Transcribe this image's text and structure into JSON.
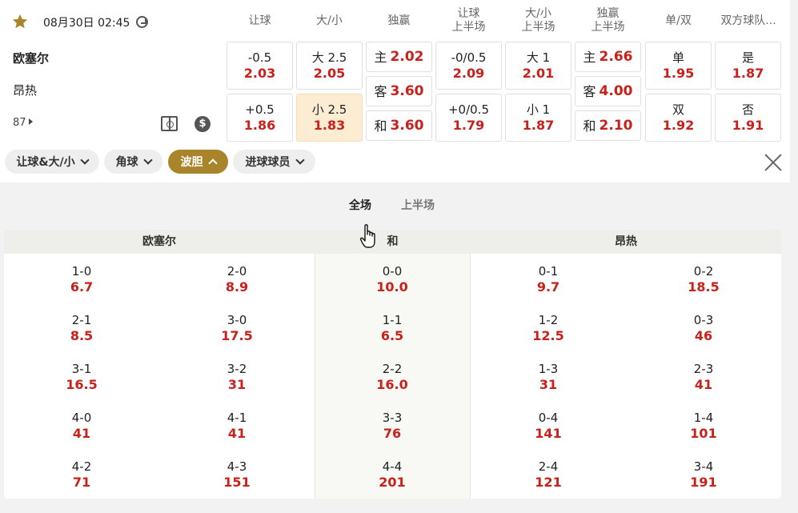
{
  "match": {
    "datetime": "08月30日 02:45",
    "home": "欧塞尔",
    "away": "昂热",
    "more_count": "87"
  },
  "columns": [
    "让球",
    "大/小",
    "独赢",
    "让球\n上半场",
    "大/小\n上半场",
    "独赢\n上半场",
    "单/双",
    "双方球队..."
  ],
  "odds": {
    "hc_top": {
      "line": "-0.5",
      "odds": "2.03"
    },
    "hc_bot": {
      "line": "+0.5",
      "odds": "1.86"
    },
    "ou_top": {
      "line": "大 2.5",
      "odds": "2.05"
    },
    "ou_bot": {
      "line": "小 2.5",
      "odds": "1.83"
    },
    "ml_home": {
      "label": "主",
      "odds": "2.02"
    },
    "ml_away": {
      "label": "客",
      "odds": "3.60"
    },
    "ml_draw": {
      "label": "和",
      "odds": "3.60"
    },
    "hc1h_top": {
      "line": "-0/0.5",
      "odds": "2.09"
    },
    "hc1h_bot": {
      "line": "+0/0.5",
      "odds": "1.79"
    },
    "ou1h_top": {
      "line": "大 1",
      "odds": "2.01"
    },
    "ou1h_bot": {
      "line": "小 1",
      "odds": "1.87"
    },
    "ml1h_home": {
      "label": "主",
      "odds": "2.66"
    },
    "ml1h_away": {
      "label": "客",
      "odds": "4.00"
    },
    "ml1h_draw": {
      "label": "和",
      "odds": "2.10"
    },
    "oe_top": {
      "label": "单",
      "odds": "1.95"
    },
    "oe_bot": {
      "label": "双",
      "odds": "1.92"
    },
    "btts_top": {
      "label": "是",
      "odds": "1.87"
    },
    "btts_bot": {
      "label": "否",
      "odds": "1.91"
    }
  },
  "chips": [
    {
      "label": "让球&大/小",
      "active": false
    },
    {
      "label": "角球",
      "active": false
    },
    {
      "label": "波胆",
      "active": true
    },
    {
      "label": "进球球员",
      "active": false
    }
  ],
  "subtabs": {
    "full": "全场",
    "half": "上半场"
  },
  "correct_score": {
    "headers": {
      "home": "欧塞尔",
      "draw": "和",
      "away": "昂热"
    },
    "rows": [
      [
        {
          "s": "1-0",
          "v": "6.7"
        },
        {
          "s": "2-0",
          "v": "8.9"
        },
        {
          "s": "0-0",
          "v": "10.0"
        },
        {
          "s": "0-1",
          "v": "9.7"
        },
        {
          "s": "0-2",
          "v": "18.5"
        }
      ],
      [
        {
          "s": "2-1",
          "v": "8.5"
        },
        {
          "s": "3-0",
          "v": "17.5"
        },
        {
          "s": "1-1",
          "v": "6.5"
        },
        {
          "s": "1-2",
          "v": "12.5"
        },
        {
          "s": "0-3",
          "v": "46"
        }
      ],
      [
        {
          "s": "3-1",
          "v": "16.5"
        },
        {
          "s": "3-2",
          "v": "31"
        },
        {
          "s": "2-2",
          "v": "16.0"
        },
        {
          "s": "1-3",
          "v": "31"
        },
        {
          "s": "2-3",
          "v": "41"
        }
      ],
      [
        {
          "s": "4-0",
          "v": "41"
        },
        {
          "s": "4-1",
          "v": "41"
        },
        {
          "s": "3-3",
          "v": "76"
        },
        {
          "s": "0-4",
          "v": "141"
        },
        {
          "s": "1-4",
          "v": "101"
        }
      ],
      [
        {
          "s": "4-2",
          "v": "71"
        },
        {
          "s": "4-3",
          "v": "151"
        },
        {
          "s": "4-4",
          "v": "201"
        },
        {
          "s": "2-4",
          "v": "121"
        },
        {
          "s": "3-4",
          "v": "191"
        }
      ]
    ]
  },
  "colors": {
    "accent": "#a8842b",
    "odds": "#c8201a",
    "highlight": "#fbecd2"
  },
  "icons": [
    "star-icon",
    "clock-icon",
    "field-icon",
    "dollar-icon",
    "close-icon",
    "chevron-down-icon",
    "chevron-up-icon",
    "hand-cursor-icon"
  ]
}
